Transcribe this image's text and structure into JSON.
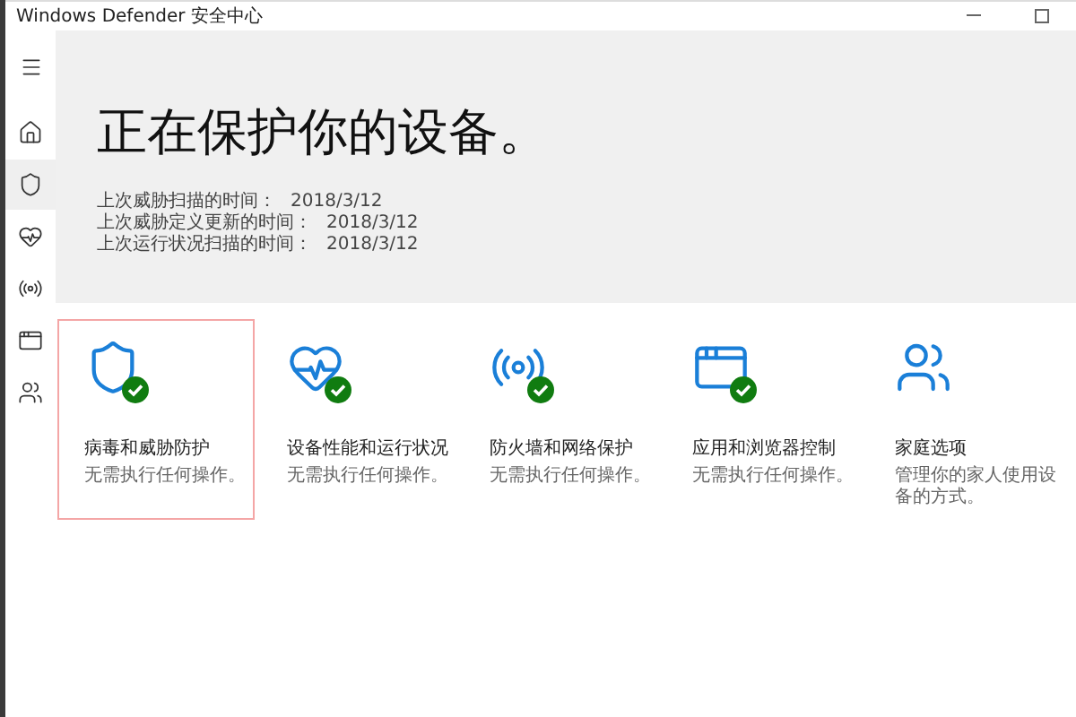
{
  "window": {
    "title": "Windows Defender 安全中心"
  },
  "sidebar": {
    "items": [
      {
        "kind": "home",
        "selected": false
      },
      {
        "kind": "shield",
        "selected": true
      },
      {
        "kind": "health",
        "selected": false
      },
      {
        "kind": "network",
        "selected": false
      },
      {
        "kind": "browser",
        "selected": false
      },
      {
        "kind": "family",
        "selected": false
      }
    ]
  },
  "header": {
    "heading": "正在保护你的设备。",
    "facts": [
      {
        "label": "上次威胁扫描的时间：",
        "value": "2018/3/12"
      },
      {
        "label": "上次威胁定义更新的时间：",
        "value": "2018/3/12"
      },
      {
        "label": "上次运行状况扫描的时间：",
        "value": "2018/3/12"
      }
    ]
  },
  "cards": [
    {
      "kind": "shield",
      "title": "病毒和威胁防护",
      "subtitle": "无需执行任何操作。",
      "protected": true,
      "selected": true
    },
    {
      "kind": "health",
      "title": "设备性能和运行状况",
      "subtitle": "无需执行任何操作。",
      "protected": true,
      "selected": false
    },
    {
      "kind": "network",
      "title": "防火墙和网络保护",
      "subtitle": "无需执行任何操作。",
      "protected": true,
      "selected": false
    },
    {
      "kind": "browser",
      "title": "应用和浏览器控制",
      "subtitle": "无需执行任何操作。",
      "protected": true,
      "selected": false
    },
    {
      "kind": "family",
      "title": "家庭选项",
      "subtitle": "管理你的家人使用设备的方式。",
      "protected": false,
      "selected": false
    }
  ]
}
